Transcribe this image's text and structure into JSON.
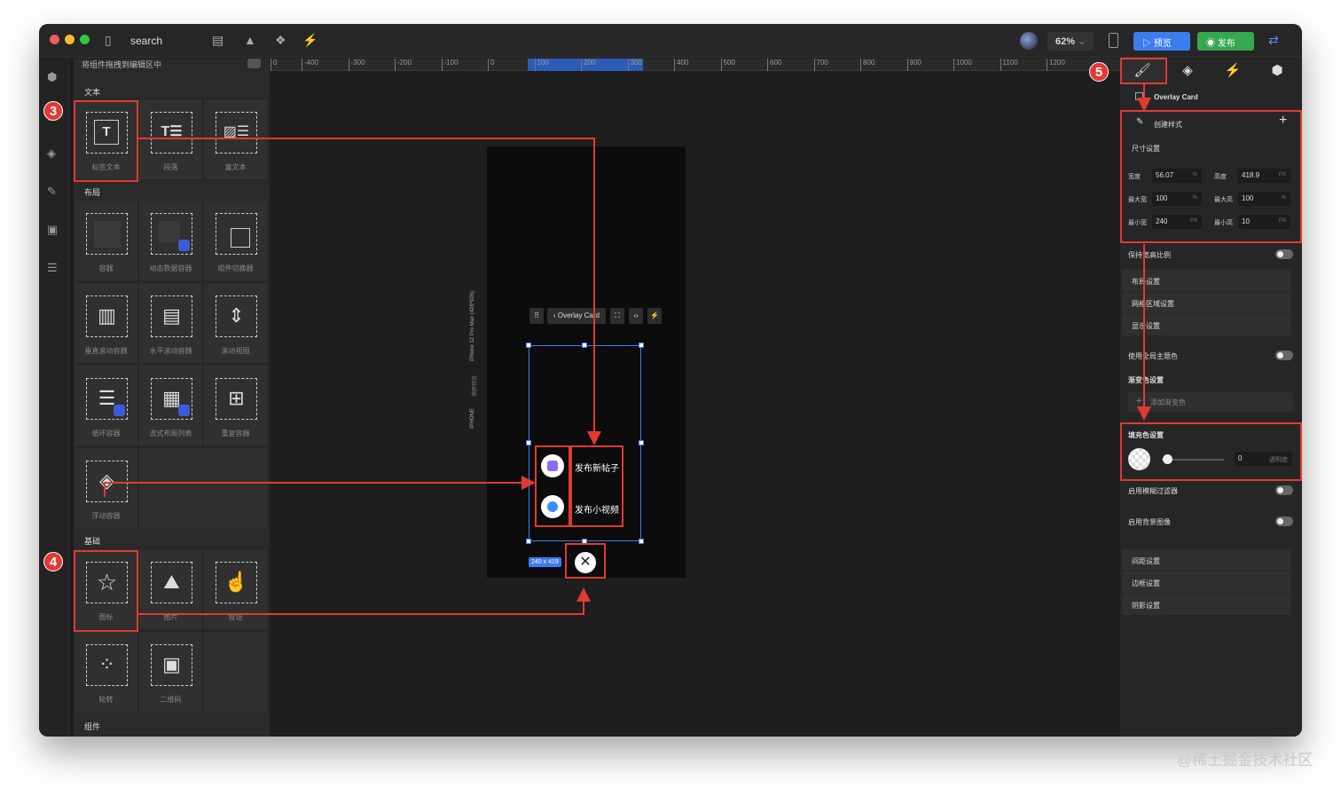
{
  "toolbar": {
    "search_label": "search",
    "zoom": "62%",
    "preview_label": "预览",
    "publish_label": "发布"
  },
  "palette": {
    "hint": "将组件拖拽到编辑区中",
    "sections": {
      "text": "文本",
      "layout": "布局",
      "basic": "基础",
      "components": "组件"
    },
    "text_items": [
      "标签文本",
      "段落",
      "富文本"
    ],
    "layout_items": [
      "容器",
      "动态数据容器",
      "组件切换器",
      "垂直滚动容器",
      "水平滚动容器",
      "滚动视图",
      "循环容器",
      "流式布局列表",
      "重复容器",
      "浮动容器"
    ],
    "basic_items": [
      "图标",
      "图片",
      "按钮",
      "轮转",
      "二维码"
    ]
  },
  "ruler": {
    "ticks": [
      "-400",
      "-300",
      "-200",
      "-100",
      "0",
      "100",
      "200",
      "300",
      "400",
      "500",
      "600",
      "700",
      "800",
      "900",
      "1000",
      "1100",
      "1200"
    ],
    "first_tick": "0"
  },
  "canvas": {
    "device_label": "iPhone 12 Pro Max (428*926)",
    "device_small_label": "IPHONE",
    "device_mid_label": "横屏预览",
    "crumb_component": "Overlay Card",
    "size_badge": "240 x 419",
    "menu_item_1": "发布新帖子",
    "menu_item_2": "发布小视频"
  },
  "rpanel": {
    "component_name": "Overlay Card",
    "create_style": "创建样式",
    "size_settings": "尺寸设置",
    "fields": {
      "width_label": "宽度",
      "width_value": "56.07",
      "width_unit": "%",
      "height_label": "高度",
      "height_value": "418.9",
      "height_unit": "PX",
      "max_width_label": "最大宽",
      "max_width_value": "100",
      "max_width_unit": "%",
      "max_height_label": "最大高",
      "max_height_value": "100",
      "max_height_unit": "%",
      "min_width_label": "最小宽",
      "min_width_value": "240",
      "min_width_unit": "PX",
      "min_height_label": "最小高",
      "min_height_value": "10",
      "min_height_unit": "PX"
    },
    "keep_ratio": "保持宽高比例",
    "layout_settings": "布局设置",
    "grid_settings": "网格区域设置",
    "display_settings": "显示设置",
    "use_theme_color": "使用全局主题色",
    "gradient_settings": "渐变色设置",
    "add_gradient": "添加渐变色",
    "fill_settings": "填充色设置",
    "opacity_value": "0",
    "opacity_label": "透明度",
    "blur_filter": "启用模糊过滤器",
    "bg_image": "启用背景图像",
    "spacing_settings": "间距设置",
    "border_settings": "边框设置",
    "shadow_settings": "阴影设置"
  },
  "annotations": {
    "badge3": "3",
    "badge4": "4",
    "badge5": "5",
    "accent": "#e03a33"
  },
  "watermark": "@稀土掘金技术社区"
}
